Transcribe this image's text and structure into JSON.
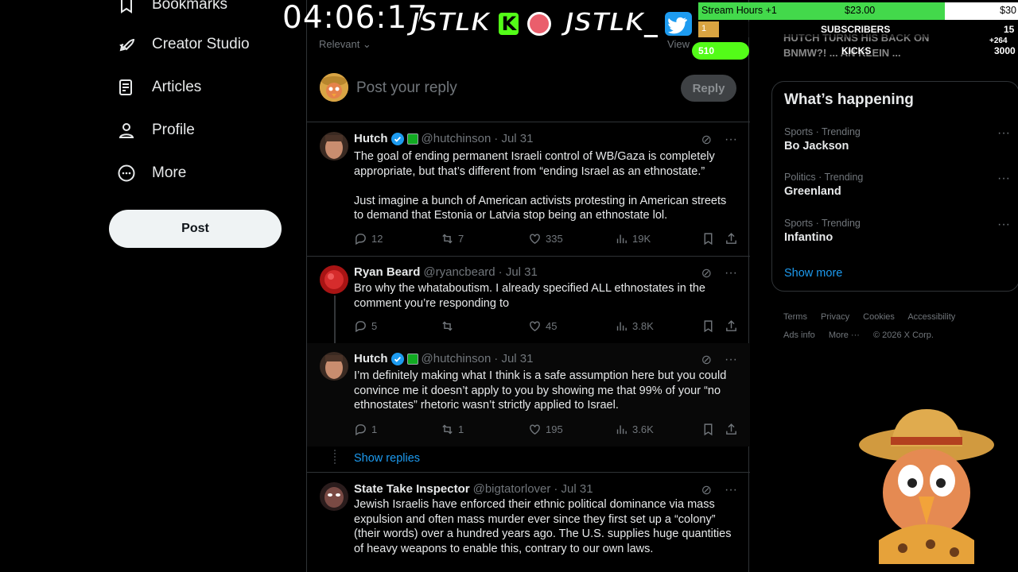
{
  "nav": {
    "items": [
      {
        "label": "Bookmarks",
        "icon": "bookmark-icon"
      },
      {
        "label": "Creator Studio",
        "icon": "rocket-icon"
      },
      {
        "label": "Articles",
        "icon": "article-icon"
      },
      {
        "label": "Profile",
        "icon": "profile-icon"
      },
      {
        "label": "More",
        "icon": "more-circle-icon"
      }
    ],
    "post_label": "Post"
  },
  "main": {
    "sort_label": "Relevant",
    "view_label": "View",
    "reply_placeholder": "Post your reply",
    "reply_button": "Reply",
    "show_replies": "Show replies",
    "tweets": [
      {
        "name": "Hutch",
        "handle": "@hutchinson",
        "date": "· Jul 31",
        "verified": true,
        "body": "The goal of ending permanent Israeli control of WB/Gaza is completely appropriate, but that’s different from “ending Israel as an ethnostate.”\n\nJust imagine a bunch of American activists protesting in American streets to demand that Estonia or Latvia stop being an ethnostate lol.",
        "replies": "12",
        "reposts": "7",
        "likes": "335",
        "views": "19K"
      },
      {
        "name": "Ryan Beard",
        "handle": "@ryancbeard",
        "date": "· Jul 31",
        "verified": false,
        "body": "Bro why the whataboutism. I already specified ALL ethnostates in the comment you’re responding to",
        "replies": "5",
        "reposts": "",
        "likes": "45",
        "views": "3.8K"
      },
      {
        "name": "Hutch",
        "handle": "@hutchinson",
        "date": "· Jul 31",
        "verified": true,
        "body": "I’m definitely making what I think is a safe assumption here but you could convince me it doesn’t apply to you by showing me that 99% of your “no ethnostates” rhetoric wasn’t strictly applied to Israel.",
        "replies": "1",
        "reposts": "1",
        "likes": "195",
        "views": "3.6K"
      },
      {
        "name": "State Take Inspector",
        "handle": "@bigtatorlover",
        "date": "· Jul 31",
        "verified": false,
        "body": "Jewish Israelis have enforced their ethnic political dominance via mass expulsion and often mass murder ever since they first set up a “colony” (their words) over a hundred years ago. The U.S. supplies huge quantities of heavy weapons to enable this, contrary to our own laws."
      }
    ]
  },
  "sidebar": {
    "title": "What’s happening",
    "trends": [
      {
        "category": "Sports · Trending",
        "topic": "Bo Jackson"
      },
      {
        "category": "Politics · Trending",
        "topic": "Greenland"
      },
      {
        "category": "Sports · Trending",
        "topic": "Infantino"
      }
    ],
    "show_more": "Show more",
    "footer": [
      "Terms",
      "Privacy",
      "Cookies",
      "Accessibility",
      "Ads info",
      "More ···",
      "© 2026 X Corp."
    ]
  },
  "overlay": {
    "clock": "04:06:17",
    "logo_text": "JSTLK",
    "goal_label": "Stream Hours +1",
    "goal_amount": "$23.00",
    "goal_target": "$30",
    "goal_progress": 0.77,
    "subscribers_label": "SUBSCRIBERS",
    "subscribers_count": "15",
    "sub_badge": "1",
    "kicks_label": "KICKS",
    "kicks_bar": "510",
    "kicks_count": "3000",
    "plus_count": "+264",
    "news_line1": "HUTCH TURNS HIS BACK ON",
    "news_line2": "BNMW?! ... AN KLEIN ..."
  },
  "colors": {
    "accent": "#1d9bf0",
    "kick_green": "#53fc18",
    "goal_green": "#43d94b"
  }
}
